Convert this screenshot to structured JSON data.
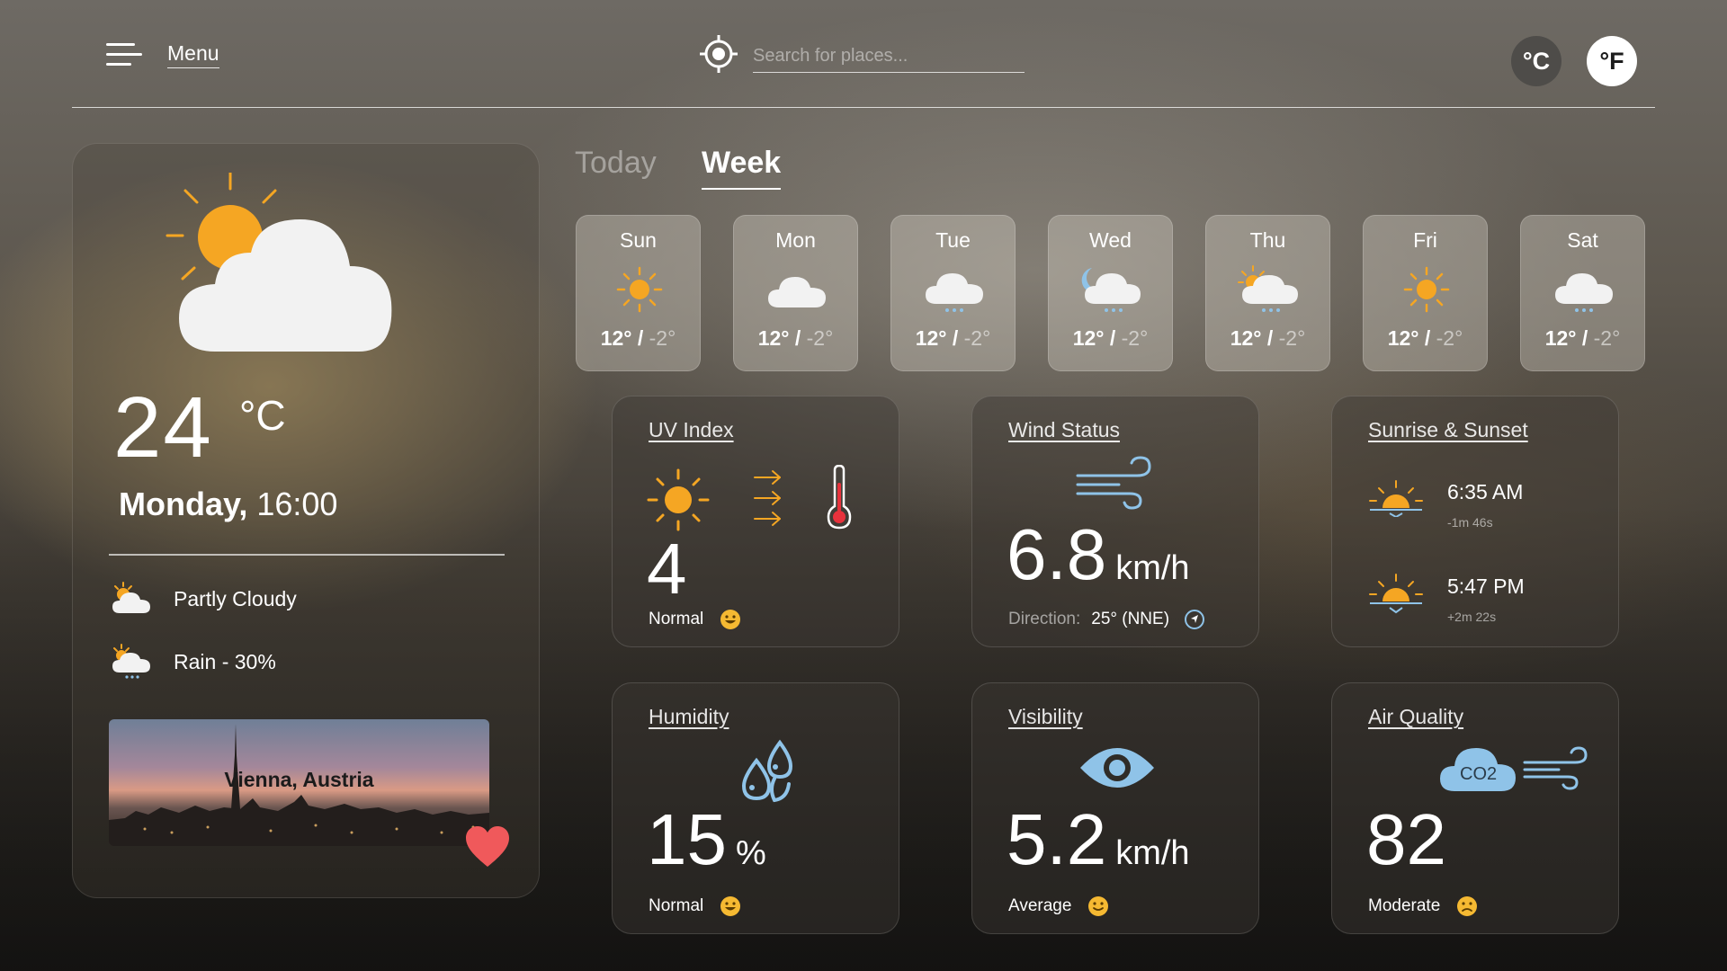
{
  "header": {
    "menu_label": "Menu",
    "search_placeholder": "Search for places...",
    "unit_c": "°C",
    "unit_f": "°F"
  },
  "current": {
    "temperature": "24",
    "unit": "°C",
    "day": "Monday,",
    "time": "16:00",
    "conditions": [
      {
        "icon": "partly-cloudy-icon",
        "label": "Partly Cloudy"
      },
      {
        "icon": "rain-cloud-icon",
        "label": "Rain - 30%"
      }
    ],
    "city": "Vienna, Austria"
  },
  "tabs": [
    {
      "label": "Today",
      "active": false
    },
    {
      "label": "Week",
      "active": true
    }
  ],
  "forecast": [
    {
      "day": "Sun",
      "icon": "sun-icon",
      "high": "12°",
      "low": "-2°"
    },
    {
      "day": "Mon",
      "icon": "cloud-icon",
      "high": "12°",
      "low": "-2°"
    },
    {
      "day": "Tue",
      "icon": "snow-cloud-icon",
      "high": "12°",
      "low": "-2°"
    },
    {
      "day": "Wed",
      "icon": "night-snow-cloud-icon",
      "high": "12°",
      "low": "-2°"
    },
    {
      "day": "Thu",
      "icon": "partly-cloudy-snow-icon",
      "high": "12°",
      "low": "-2°"
    },
    {
      "day": "Fri",
      "icon": "sun-icon",
      "high": "12°",
      "low": "-2°"
    },
    {
      "day": "Sat",
      "icon": "snow-cloud-icon",
      "high": "12°",
      "low": "-2°"
    }
  ],
  "highlights": {
    "uv": {
      "title": "UV Index",
      "value": "4",
      "status": "Normal",
      "status_icon": "happy-face-icon"
    },
    "wind": {
      "title": "Wind Status",
      "value": "6.8",
      "unit": "km/h",
      "direction_label": "Direction:",
      "direction_value": "25° (NNE)"
    },
    "sun": {
      "title": "Sunrise & Sunset",
      "sunrise": "6:35 AM",
      "sunrise_delta": "-1m 46s",
      "sunset": "5:47 PM",
      "sunset_delta": "+2m 22s"
    },
    "humidity": {
      "title": "Humidity",
      "value": "15",
      "unit": "%",
      "status": "Normal",
      "status_icon": "happy-face-icon"
    },
    "visibility": {
      "title": "Visibility",
      "value": "5.2",
      "unit": "km/h",
      "status": "Average",
      "status_icon": "smile-face-icon"
    },
    "air": {
      "title": "Air Quality",
      "value": "82",
      "co2_label": "CO2",
      "status": "Moderate",
      "status_icon": "sad-face-icon"
    }
  },
  "colors": {
    "sun": "#f5a623",
    "cloud": "#f2f2f2",
    "accent_blue": "#8fc3e8",
    "heart": "#f0595b",
    "thermo_red": "#e8323c"
  }
}
